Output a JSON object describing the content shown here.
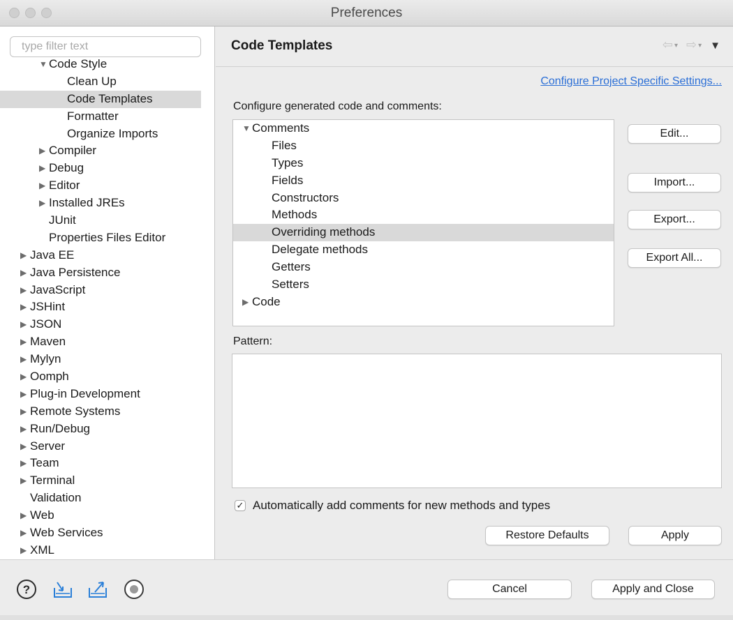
{
  "window": {
    "title": "Preferences"
  },
  "sidebar": {
    "filter_placeholder": "type filter text",
    "items": [
      {
        "label": "Code Style",
        "indent": 3,
        "arrow": "down"
      },
      {
        "label": "Clean Up",
        "indent": 5,
        "arrow": ""
      },
      {
        "label": "Code Templates",
        "indent": 5,
        "arrow": "",
        "selected": true
      },
      {
        "label": "Formatter",
        "indent": 5,
        "arrow": ""
      },
      {
        "label": "Organize Imports",
        "indent": 5,
        "arrow": ""
      },
      {
        "label": "Compiler",
        "indent": 3,
        "arrow": "right"
      },
      {
        "label": "Debug",
        "indent": 3,
        "arrow": "right"
      },
      {
        "label": "Editor",
        "indent": 3,
        "arrow": "right"
      },
      {
        "label": "Installed JREs",
        "indent": 3,
        "arrow": "right"
      },
      {
        "label": "JUnit",
        "indent": 3,
        "arrow": ""
      },
      {
        "label": "Properties Files Editor",
        "indent": 3,
        "arrow": ""
      },
      {
        "label": "Java EE",
        "indent": 1,
        "arrow": "right"
      },
      {
        "label": "Java Persistence",
        "indent": 1,
        "arrow": "right"
      },
      {
        "label": "JavaScript",
        "indent": 1,
        "arrow": "right"
      },
      {
        "label": "JSHint",
        "indent": 1,
        "arrow": "right"
      },
      {
        "label": "JSON",
        "indent": 1,
        "arrow": "right"
      },
      {
        "label": "Maven",
        "indent": 1,
        "arrow": "right"
      },
      {
        "label": "Mylyn",
        "indent": 1,
        "arrow": "right"
      },
      {
        "label": "Oomph",
        "indent": 1,
        "arrow": "right"
      },
      {
        "label": "Plug-in Development",
        "indent": 1,
        "arrow": "right"
      },
      {
        "label": "Remote Systems",
        "indent": 1,
        "arrow": "right"
      },
      {
        "label": "Run/Debug",
        "indent": 1,
        "arrow": "right"
      },
      {
        "label": "Server",
        "indent": 1,
        "arrow": "right"
      },
      {
        "label": "Team",
        "indent": 1,
        "arrow": "right"
      },
      {
        "label": "Terminal",
        "indent": 1,
        "arrow": "right"
      },
      {
        "label": "Validation",
        "indent": 1,
        "arrow": ""
      },
      {
        "label": "Web",
        "indent": 1,
        "arrow": "right"
      },
      {
        "label": "Web Services",
        "indent": 1,
        "arrow": "right"
      },
      {
        "label": "XML",
        "indent": 1,
        "arrow": "right"
      }
    ]
  },
  "main": {
    "title": "Code Templates",
    "config_link": "Configure Project Specific Settings...",
    "configure_label": "Configure generated code and comments:",
    "templates": [
      {
        "label": "Comments",
        "level": 0,
        "arrow": "down"
      },
      {
        "label": "Files",
        "level": 1,
        "arrow": ""
      },
      {
        "label": "Types",
        "level": 1,
        "arrow": ""
      },
      {
        "label": "Fields",
        "level": 1,
        "arrow": ""
      },
      {
        "label": "Constructors",
        "level": 1,
        "arrow": ""
      },
      {
        "label": "Methods",
        "level": 1,
        "arrow": ""
      },
      {
        "label": "Overriding methods",
        "level": 1,
        "arrow": "",
        "selected": true
      },
      {
        "label": "Delegate methods",
        "level": 1,
        "arrow": ""
      },
      {
        "label": "Getters",
        "level": 1,
        "arrow": ""
      },
      {
        "label": "Setters",
        "level": 1,
        "arrow": ""
      },
      {
        "label": "Code",
        "level": 0,
        "arrow": "right"
      }
    ],
    "buttons": {
      "edit": "Edit...",
      "import": "Import...",
      "export": "Export...",
      "export_all": "Export All..."
    },
    "pattern_label": "Pattern:",
    "pattern_value": "",
    "auto_comments": {
      "label": "Automatically add comments for new methods and types",
      "checked": true
    },
    "restore_defaults": "Restore Defaults",
    "apply": "Apply"
  },
  "footer": {
    "icons": [
      "help-icon",
      "import-prefs-icon",
      "export-prefs-icon",
      "record-icon"
    ],
    "cancel": "Cancel",
    "apply_close": "Apply and Close"
  }
}
